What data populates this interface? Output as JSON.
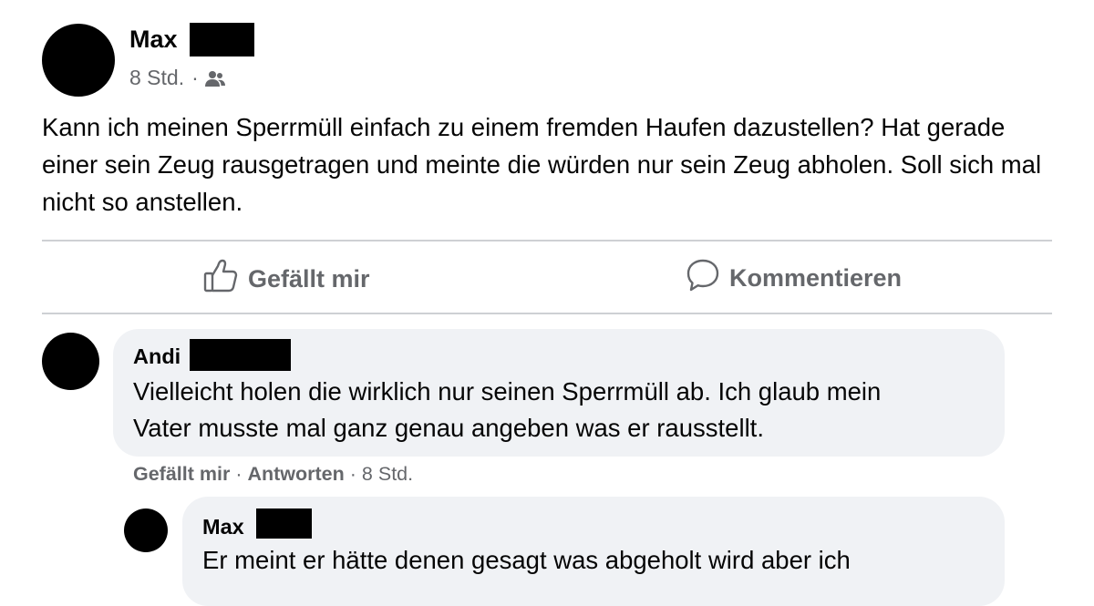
{
  "post": {
    "author": "Max",
    "time": "8 Std.",
    "separator": "·",
    "audience_icon": "friends-icon",
    "text": "Kann ich meinen Sperrmüll einfach zu einem fremden Haufen dazustellen? Hat gerade einer sein Zeug rausgetragen und meinte die würden nur sein Zeug abholen. Soll sich mal nicht so anstellen."
  },
  "actions": {
    "like_label": "Gefällt mir",
    "like_icon": "thumbs-up-icon",
    "comment_label": "Kommentieren",
    "comment_icon": "speech-bubble-icon"
  },
  "comments": [
    {
      "author": "Andi",
      "text_line1": "Vielleicht holen die wirklich nur seinen Sperrmüll ab. Ich glaub mein",
      "text_line2": "Vater musste mal ganz genau angeben was er rausstellt.",
      "like_label": "Gefällt mir",
      "reply_label": "Antworten",
      "time": "8 Std.",
      "separator": "·"
    }
  ],
  "replies": [
    {
      "author": "Max",
      "text": "Er meint er hätte denen gesagt was abgeholt wird aber ich"
    }
  ],
  "colors": {
    "secondary_text": "#65676b",
    "bubble": "#f0f2f5",
    "divider": "#ced0d4"
  }
}
